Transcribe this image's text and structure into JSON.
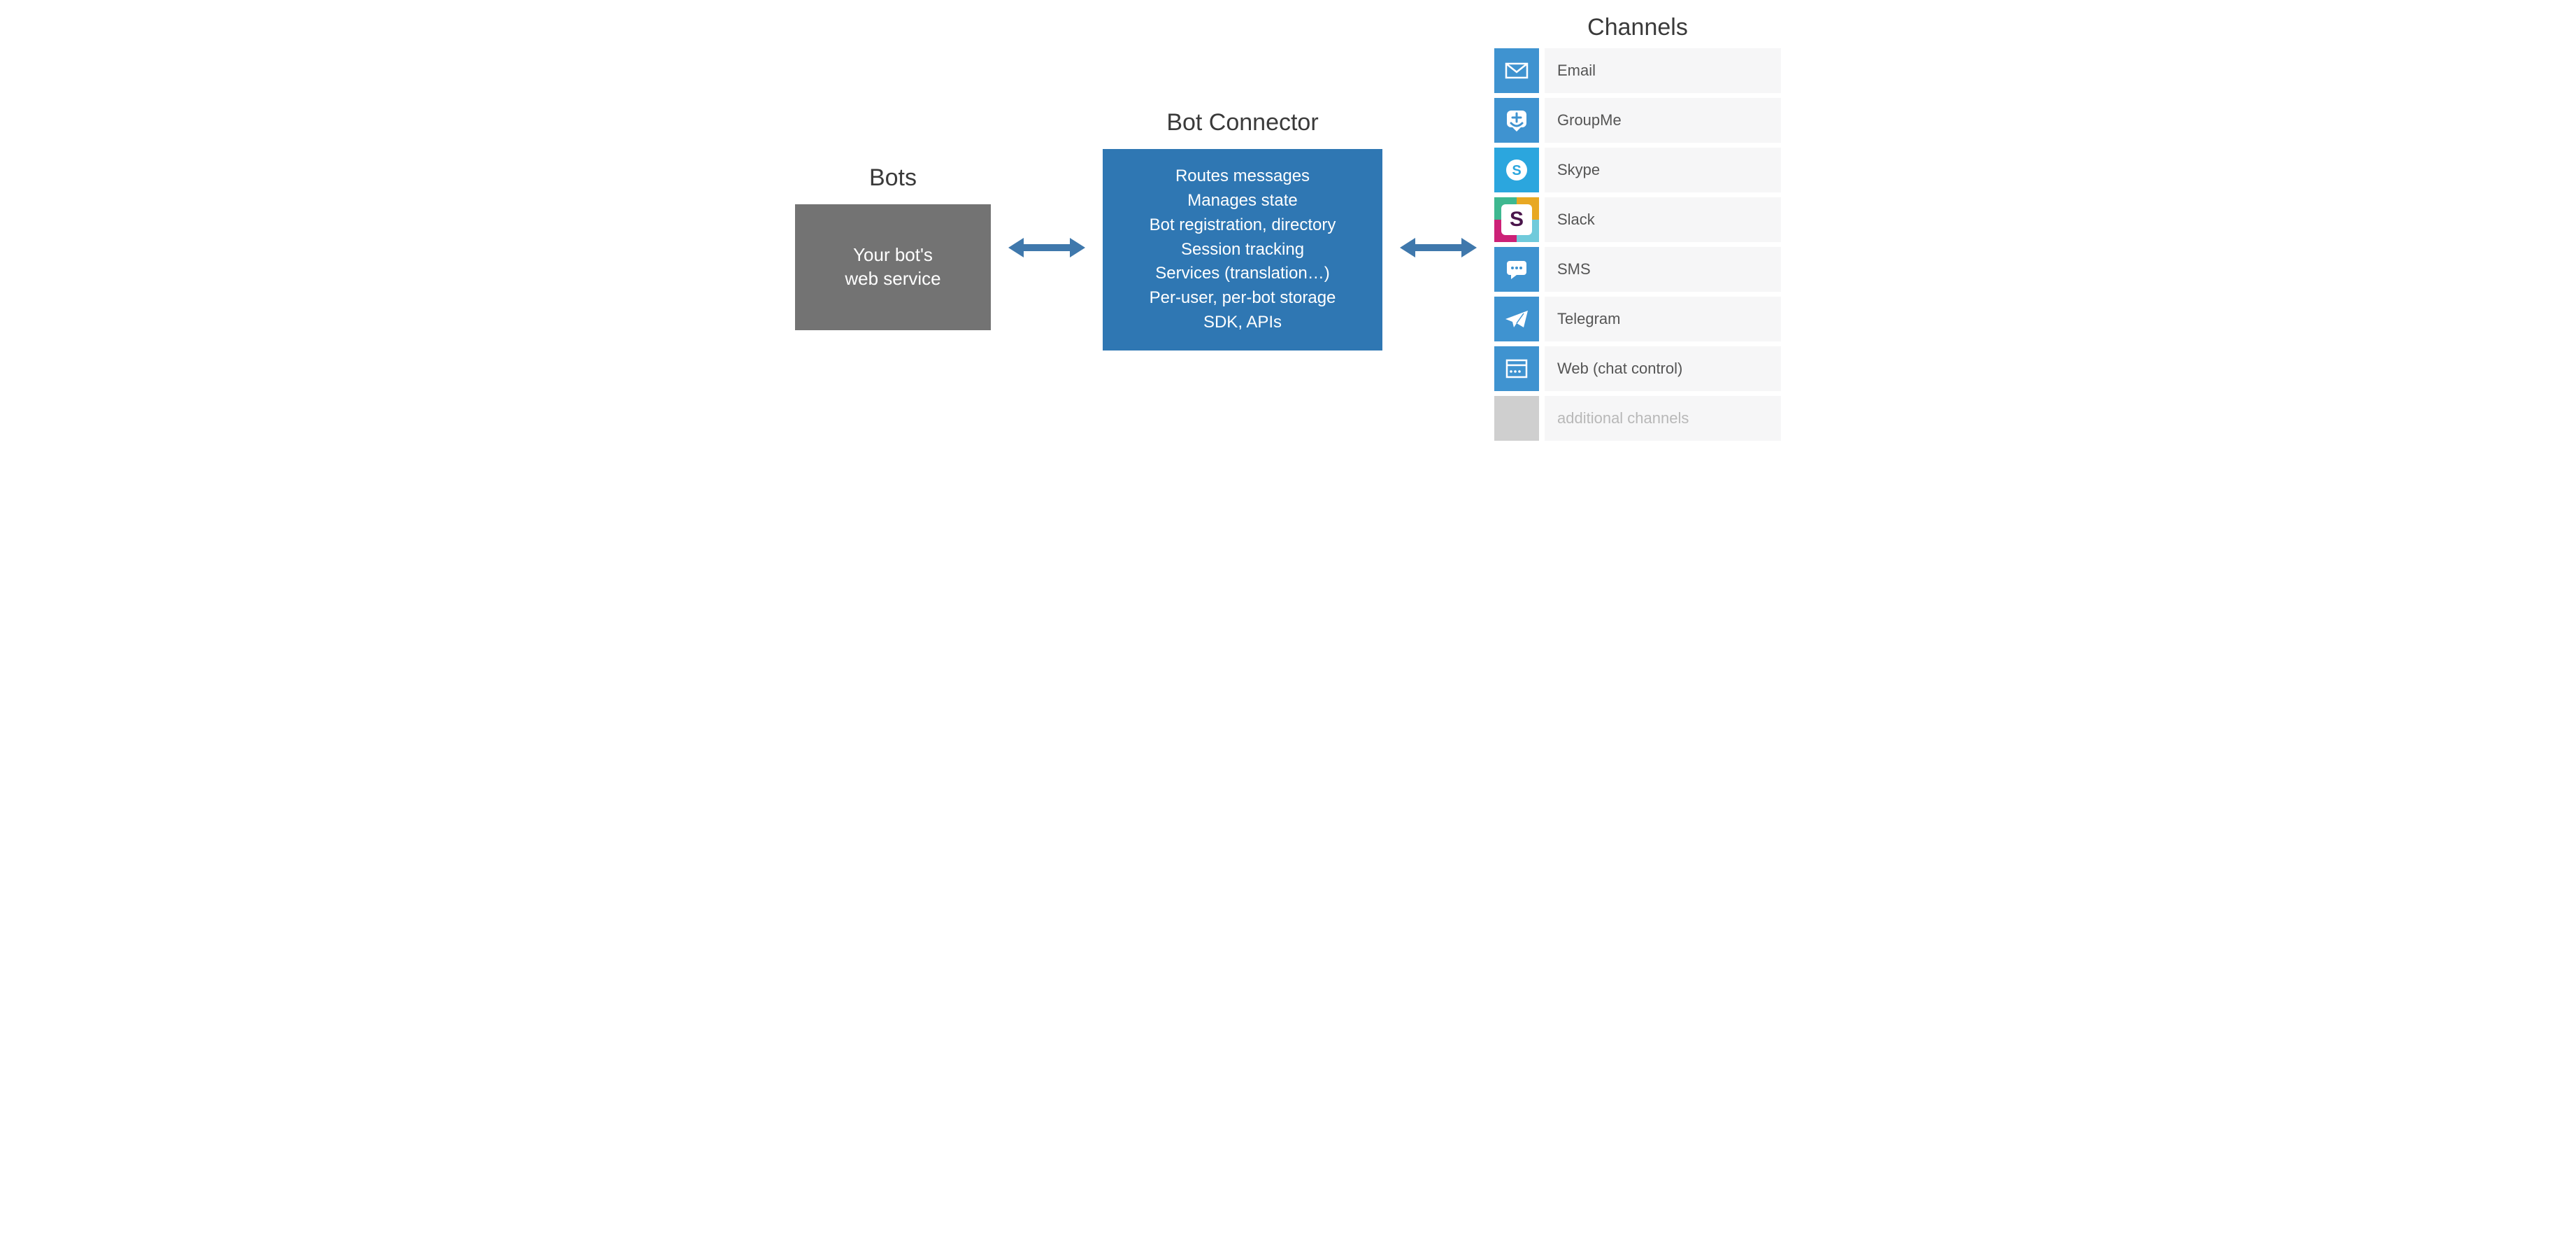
{
  "bots": {
    "title": "Bots",
    "box_line1": "Your bot's",
    "box_line2": "web service"
  },
  "connector": {
    "title": "Bot Connector",
    "lines": [
      "Routes messages",
      "Manages state",
      "Bot registration, directory",
      "Session tracking",
      "Services (translation…)",
      "Per-user, per-bot storage",
      "SDK, APIs"
    ]
  },
  "channels": {
    "title": "Channels",
    "items": [
      {
        "label": "Email",
        "icon": "mail-icon",
        "bg": "bg-blue"
      },
      {
        "label": "GroupMe",
        "icon": "groupme-icon",
        "bg": "bg-blue"
      },
      {
        "label": "Skype",
        "icon": "skype-icon",
        "bg": "bg-skype"
      },
      {
        "label": "Slack",
        "icon": "slack-icon",
        "bg": "slack"
      },
      {
        "label": "SMS",
        "icon": "sms-icon",
        "bg": "bg-blue"
      },
      {
        "label": "Telegram",
        "icon": "telegram-icon",
        "bg": "bg-blue"
      },
      {
        "label": "Web (chat control)",
        "icon": "web-icon",
        "bg": "bg-blue"
      },
      {
        "label": "additional channels",
        "icon": "blank-icon",
        "bg": "bg-gray",
        "muted": true
      }
    ]
  },
  "colors": {
    "bots_box": "#737373",
    "connector_box": "#2f77b3",
    "arrow": "#3f78ac",
    "channel_tile": "#3f93d0",
    "channel_label_bg": "#f6f6f7"
  }
}
